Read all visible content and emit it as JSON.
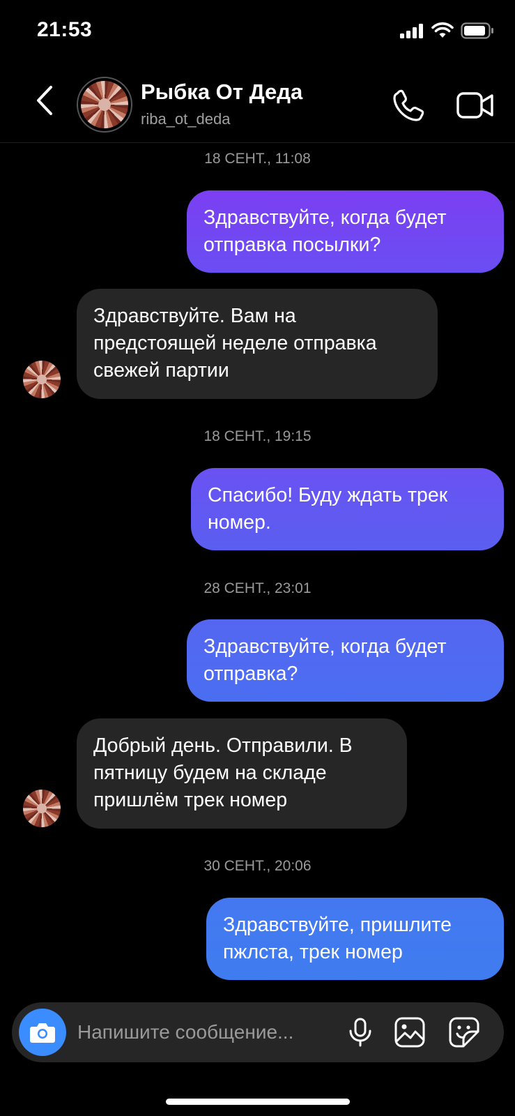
{
  "status_bar": {
    "time": "21:53"
  },
  "header": {
    "back_icon": "chevron-left-icon",
    "contact_name": "Рыбка От Деда",
    "contact_handle": "riba_ot_deda",
    "call_icon": "phone-icon",
    "video_icon": "video-camera-icon"
  },
  "thread": {
    "timestamps": [
      "18 СЕНТ., 11:08",
      "18 СЕНТ., 19:15",
      "28 СЕНТ., 23:01",
      "30 СЕНТ., 20:06"
    ],
    "messages": [
      {
        "direction": "outgoing",
        "lines": [
          "Здравствуйте, когда будет",
          "отправка посылки?"
        ]
      },
      {
        "direction": "incoming",
        "lines": [
          "Здравствуйте. Вам на",
          "предстоящей неделе отправка",
          "свежей партии"
        ]
      },
      {
        "direction": "outgoing",
        "lines": [
          "Спасибо! Буду ждать трек",
          "номер."
        ]
      },
      {
        "direction": "outgoing",
        "lines": [
          "Здравствуйте, когда будет",
          "отправка?"
        ]
      },
      {
        "direction": "incoming",
        "lines": [
          "Добрый день. Отправили. В",
          "пятницу будем на складе",
          "пришлём трек номер"
        ]
      },
      {
        "direction": "outgoing",
        "lines": [
          "Здравствуйте, пришлите",
          "пжлста, трек номер"
        ]
      }
    ]
  },
  "composer": {
    "placeholder": "Напишите сообщение...",
    "camera_icon": "camera-icon",
    "mic_icon": "microphone-icon",
    "gallery_icon": "gallery-icon",
    "sticker_icon": "sticker-icon"
  },
  "colors": {
    "background": "#000000",
    "incoming_bubble": "#262626",
    "outgoing_gradient_top": "#7b3ff2",
    "outgoing_gradient_bottom": "#3f7cf0",
    "camera_button": "#3a8cff"
  }
}
